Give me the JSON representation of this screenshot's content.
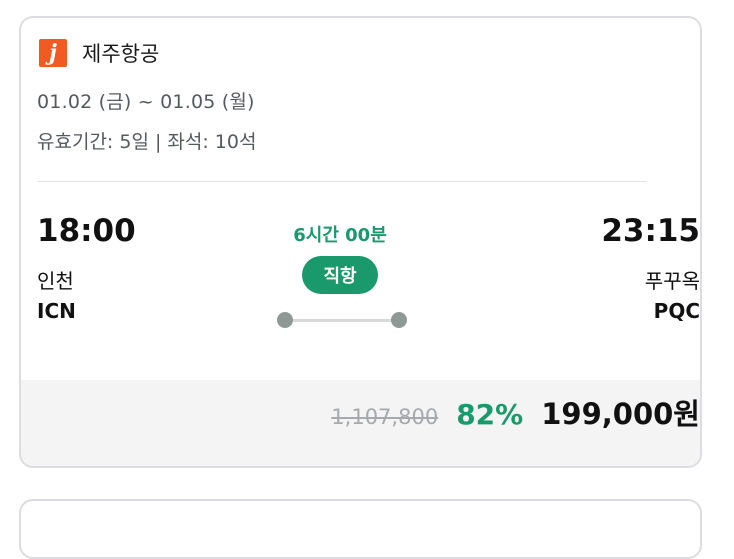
{
  "airline": {
    "logo_letter": "j",
    "name": "제주항공",
    "brand_color": "#f15a22"
  },
  "trip": {
    "dates": "01.02 (금) ~ 01.05 (월)",
    "validity": "유효기간: 5일 | 좌석: 10석"
  },
  "flight": {
    "departure": {
      "time": "18:00",
      "city": "인천",
      "code": "ICN"
    },
    "arrival": {
      "time": "23:15",
      "city": "푸꾸옥",
      "code": "PQC"
    },
    "duration": "6시간 00분",
    "type_badge": "직항"
  },
  "price": {
    "original": "1,107,800",
    "discount": "82%",
    "final": "199,000원"
  },
  "colors": {
    "accent_green": "#1a9a6c",
    "route_dot": "#8e9996",
    "price_area_bg": "#f4f4f5"
  }
}
